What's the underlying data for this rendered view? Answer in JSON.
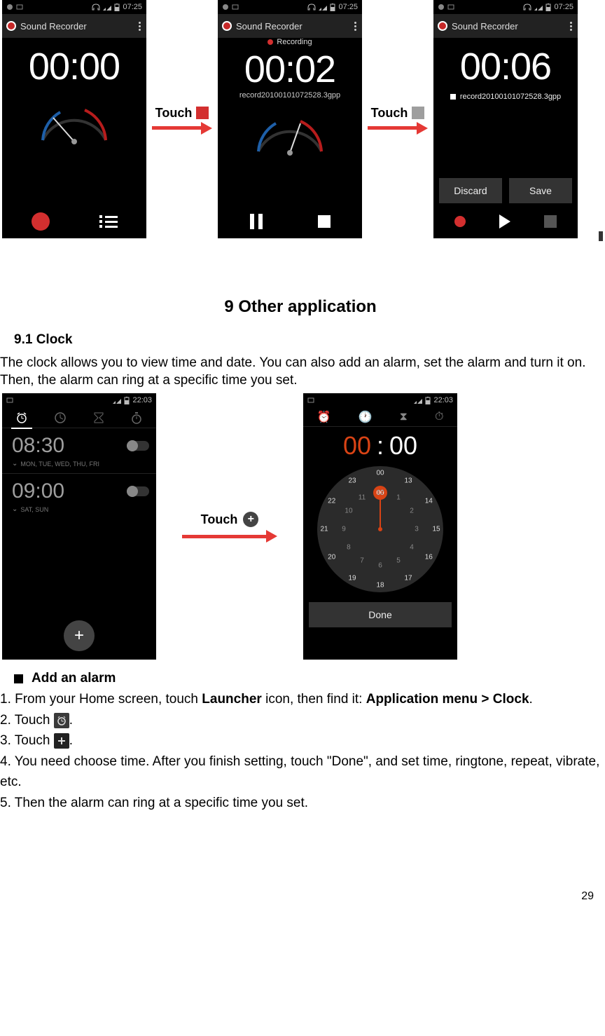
{
  "statusbar": {
    "time": "07:25",
    "time_clock": "22:03",
    "carrier": ""
  },
  "recorder": {
    "app_title": "Sound Recorder",
    "screen1": {
      "time": "00:00"
    },
    "screen2": {
      "time": "00:02",
      "status": "Recording",
      "filename": "record20100101072528.3gpp"
    },
    "screen3": {
      "time": "00:06",
      "filename": "record20100101072528.3gpp",
      "discard": "Discard",
      "save": "Save"
    },
    "touch_label": "Touch"
  },
  "chapter": {
    "title": "9    Other application"
  },
  "section": {
    "title": "9.1     Clock"
  },
  "intro_para": "The clock allows you to view time and date. You can also add an alarm, set the alarm and turn it on. Then, the alarm can ring at a specific time you set.",
  "clock": {
    "touch_label": "Touch",
    "alarms": [
      {
        "time": "08:30",
        "days": "MON, TUE, WED, THU, FRI"
      },
      {
        "time": "09:00",
        "days": "SAT, SUN"
      }
    ],
    "picker": {
      "hh": "00",
      "mm": "00",
      "done": "Done",
      "outer": [
        "00",
        "13",
        "14",
        "15",
        "16",
        "17",
        "18",
        "19",
        "20",
        "21",
        "22",
        "23"
      ],
      "inner": [
        "12",
        "1",
        "2",
        "3",
        "4",
        "5",
        "6",
        "7",
        "8",
        "9",
        "10",
        "11"
      ]
    }
  },
  "bullet": {
    "title": "Add an alarm"
  },
  "steps": {
    "s1_a": "1. From your Home screen, touch ",
    "s1_launcher": "Launcher",
    "s1_b": " icon, then find it: ",
    "s1_appmenu": "Application menu > Clock",
    "s1_c": ".",
    "s2_a": "2. Touch ",
    "s2_b": ".",
    "s3_a": "3. Touch ",
    "s3_b": ".",
    "s4": "4. You need choose time. After you finish setting, touch \"Done\", and set time, ringtone, repeat, vibrate, etc.",
    "s5": "5. Then the alarm can ring at a specific time you set."
  },
  "page_number": "29"
}
